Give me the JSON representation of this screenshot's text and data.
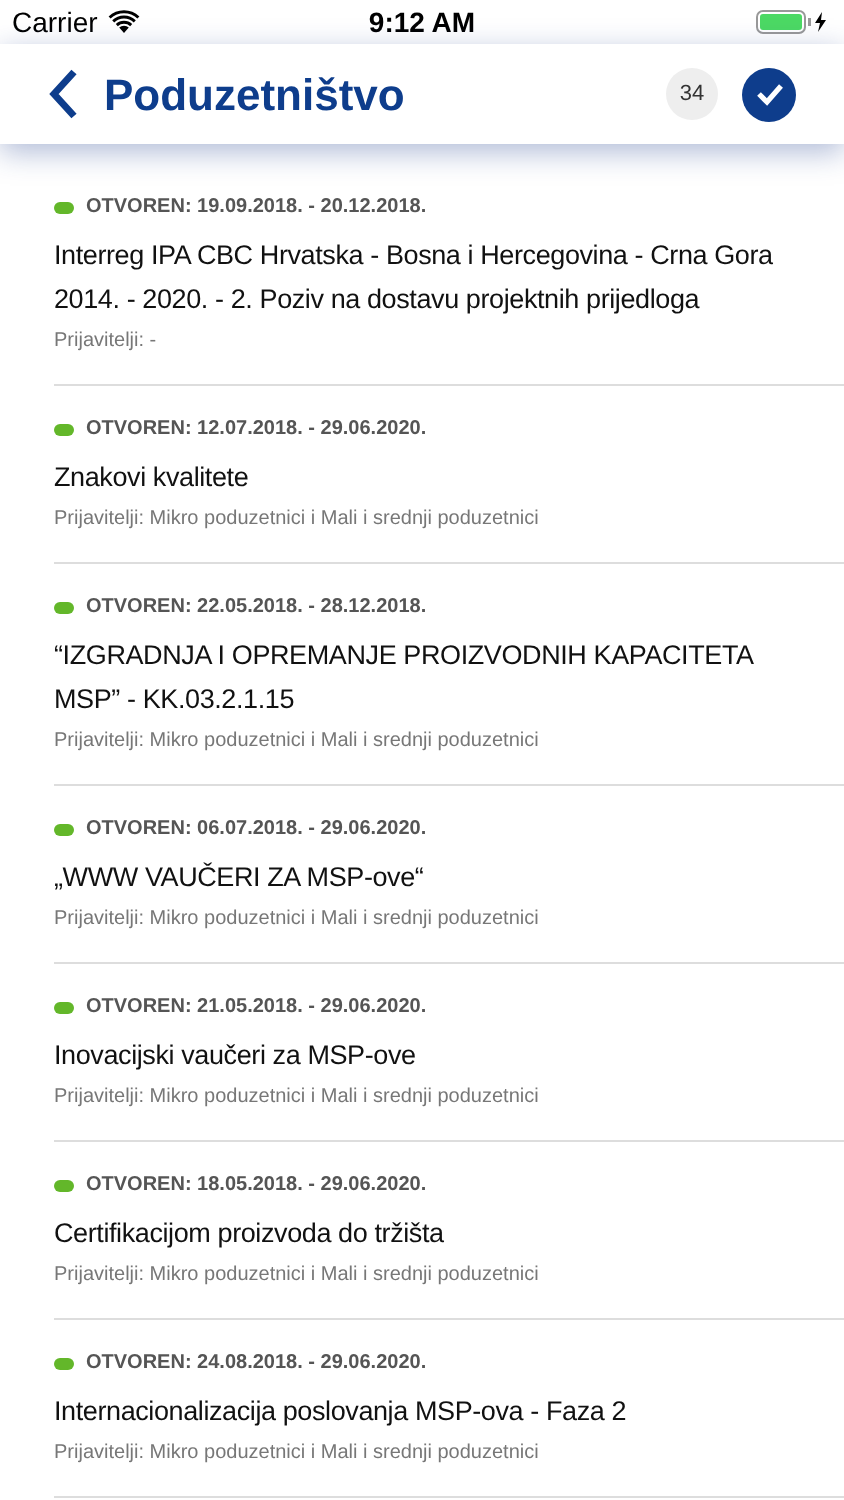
{
  "status_bar": {
    "carrier": "Carrier",
    "time": "9:12 AM"
  },
  "nav": {
    "title": "Poduzetništvo",
    "count": "34"
  },
  "items": [
    {
      "status": "OTVOREN: 19.09.2018. - 20.12.2018.",
      "color": "#63b72a",
      "title": "Interreg IPA CBC Hrvatska - Bosna i Hercegovina - Crna Gora 2014. - 2020. - 2. Poziv na dostavu projektnih prijedloga",
      "applicants": "Prijavitelji: -"
    },
    {
      "status": "OTVOREN: 12.07.2018. - 29.06.2020.",
      "color": "#63b72a",
      "title": "Znakovi kvalitete",
      "applicants": "Prijavitelji: Mikro poduzetnici i Mali i srednji poduzetnici"
    },
    {
      "status": "OTVOREN: 22.05.2018. - 28.12.2018.",
      "color": "#63b72a",
      "title": "“IZGRADNJA I OPREMANJE PROIZVODNIH KAPACITETA MSP” - KK.03.2.1.15",
      "applicants": "Prijavitelji: Mikro poduzetnici i Mali i srednji poduzetnici"
    },
    {
      "status": "OTVOREN: 06.07.2018. - 29.06.2020.",
      "color": "#63b72a",
      "title": "„WWW VAUČERI ZA MSP-ove“",
      "applicants": "Prijavitelji: Mikro poduzetnici i Mali i srednji poduzetnici"
    },
    {
      "status": "OTVOREN: 21.05.2018. - 29.06.2020.",
      "color": "#63b72a",
      "title": "Inovacijski vaučeri za MSP-ove",
      "applicants": "Prijavitelji: Mikro poduzetnici i Mali i srednji poduzetnici"
    },
    {
      "status": "OTVOREN: 18.05.2018. - 29.06.2020.",
      "color": "#63b72a",
      "title": "Certifikacijom proizvoda do tržišta",
      "applicants": "Prijavitelji: Mikro poduzetnici i Mali i srednji poduzetnici"
    },
    {
      "status": "OTVOREN: 24.08.2018. - 29.06.2020.",
      "color": "#63b72a",
      "title": "Internacionalizacija poslovanja MSP-ova - Faza 2",
      "applicants": "Prijavitelji: Mikro poduzetnici i Mali i srednji poduzetnici"
    }
  ]
}
